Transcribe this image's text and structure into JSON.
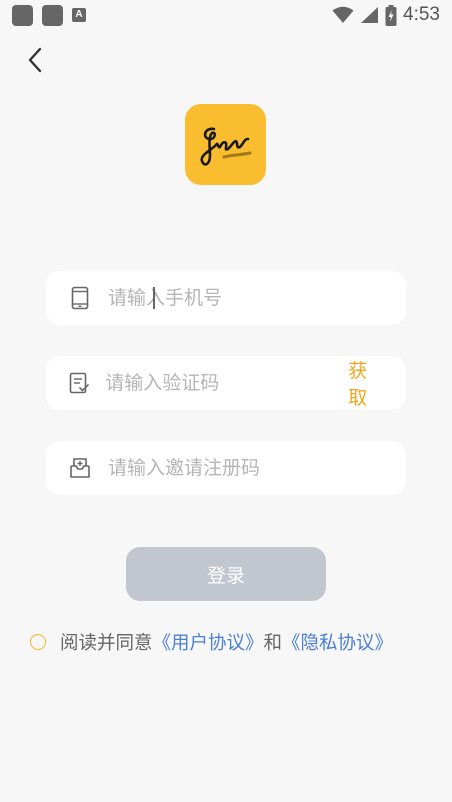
{
  "status_bar": {
    "time": "4:53",
    "left_icons": [
      "app-notification-icon",
      "app-notification-icon",
      "text-a-icon"
    ],
    "right_icons": [
      "wifi-icon",
      "cell-signal-icon",
      "battery-charging-icon"
    ]
  },
  "nav": {
    "back_icon": "chevron-left-icon"
  },
  "logo": {
    "color": "#f9bd2f"
  },
  "form": {
    "phone": {
      "placeholder": "请输入手机号",
      "icon": "phone-icon"
    },
    "code": {
      "placeholder": "请输入验证码",
      "icon": "verify-doc-icon",
      "get_label": "获取"
    },
    "invite": {
      "placeholder": "请输入邀请注册码",
      "icon": "invite-box-icon"
    }
  },
  "login": {
    "label": "登录"
  },
  "agreement": {
    "prefix": "阅读并同意",
    "user_link": "《用户协议》",
    "and": "和",
    "privacy_link": "《隐私协议》",
    "checked": false
  },
  "colors": {
    "accent": "#f3a51e",
    "link": "#4a7fd4",
    "button_disabled": "#c2c6cf",
    "background": "#f7f7f7"
  }
}
